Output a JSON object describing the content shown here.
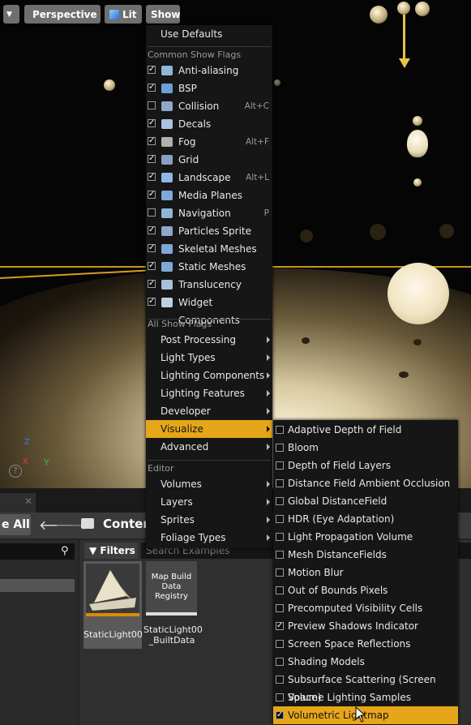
{
  "toolbar": {
    "perspective_label": "Perspective",
    "lit_label": "Lit",
    "show_label": "Show"
  },
  "show_menu": {
    "use_defaults": "Use Defaults",
    "common_header": "Common Show Flags",
    "common_flags": [
      {
        "label": "Anti-aliasing",
        "checked": true,
        "shortcut": "",
        "icon": "anti-aliasing-icon",
        "color": "#8fb7d8"
      },
      {
        "label": "BSP",
        "checked": true,
        "shortcut": "",
        "icon": "bsp-icon",
        "color": "#6f9fd8"
      },
      {
        "label": "Collision",
        "checked": false,
        "shortcut": "Alt+C",
        "icon": "collision-icon",
        "color": "#8fa8c8"
      },
      {
        "label": "Decals",
        "checked": true,
        "shortcut": "",
        "icon": "decals-icon",
        "color": "#aac4e0"
      },
      {
        "label": "Fog",
        "checked": true,
        "shortcut": "Alt+F",
        "icon": "fog-icon",
        "color": "#b0b0b0"
      },
      {
        "label": "Grid",
        "checked": true,
        "shortcut": "",
        "icon": "grid-icon",
        "color": "#8aa0c0"
      },
      {
        "label": "Landscape",
        "checked": true,
        "shortcut": "Alt+L",
        "icon": "landscape-icon",
        "color": "#8fb7e8"
      },
      {
        "label": "Media Planes",
        "checked": true,
        "shortcut": "",
        "icon": "media-planes-icon",
        "color": "#7fa8d8"
      },
      {
        "label": "Navigation",
        "checked": false,
        "shortcut": "P",
        "icon": "navigation-icon",
        "color": "#8fb7d8"
      },
      {
        "label": "Particles Sprite",
        "checked": true,
        "shortcut": "",
        "icon": "particles-icon",
        "color": "#8fa8c8"
      },
      {
        "label": "Skeletal Meshes",
        "checked": true,
        "shortcut": "",
        "icon": "skeletal-mesh-icon",
        "color": "#7fa8d8"
      },
      {
        "label": "Static Meshes",
        "checked": true,
        "shortcut": "",
        "icon": "static-mesh-icon",
        "color": "#7fa8d8"
      },
      {
        "label": "Translucency",
        "checked": true,
        "shortcut": "",
        "icon": "translucency-icon",
        "color": "#a8c0d8"
      },
      {
        "label": "Widget Components",
        "checked": true,
        "shortcut": "",
        "icon": "widget-components-icon",
        "color": "#c0d0e0"
      }
    ],
    "all_header": "All Show Flags",
    "all_items": [
      {
        "label": "Post Processing",
        "highlighted": false
      },
      {
        "label": "Light Types",
        "highlighted": false
      },
      {
        "label": "Lighting Components",
        "highlighted": false
      },
      {
        "label": "Lighting Features",
        "highlighted": false
      },
      {
        "label": "Developer",
        "highlighted": false
      },
      {
        "label": "Visualize",
        "highlighted": true
      },
      {
        "label": "Advanced",
        "highlighted": false
      }
    ],
    "editor_header": "Editor",
    "editor_items": [
      {
        "label": "Volumes"
      },
      {
        "label": "Layers"
      },
      {
        "label": "Sprites"
      },
      {
        "label": "Foliage Types"
      }
    ]
  },
  "visualize_menu": {
    "items": [
      {
        "label": "Adaptive Depth of Field",
        "checked": false,
        "highlighted": false
      },
      {
        "label": "Bloom",
        "checked": false,
        "highlighted": false
      },
      {
        "label": "Depth of Field Layers",
        "checked": false,
        "highlighted": false
      },
      {
        "label": "Distance Field Ambient Occlusion",
        "checked": false,
        "highlighted": false
      },
      {
        "label": "Global DistanceField",
        "checked": false,
        "highlighted": false
      },
      {
        "label": "HDR (Eye Adaptation)",
        "checked": false,
        "highlighted": false
      },
      {
        "label": "Light Propagation Volume",
        "checked": false,
        "highlighted": false
      },
      {
        "label": "Mesh DistanceFields",
        "checked": false,
        "highlighted": false
      },
      {
        "label": "Motion Blur",
        "checked": false,
        "highlighted": false
      },
      {
        "label": "Out of Bounds Pixels",
        "checked": false,
        "highlighted": false
      },
      {
        "label": "Precomputed Visibility Cells",
        "checked": false,
        "highlighted": false
      },
      {
        "label": "Preview Shadows Indicator",
        "checked": true,
        "highlighted": false
      },
      {
        "label": "Screen Space Reflections",
        "checked": false,
        "highlighted": false
      },
      {
        "label": "Shading Models",
        "checked": false,
        "highlighted": false
      },
      {
        "label": "Subsurface Scattering (Screen Space)",
        "checked": false,
        "highlighted": false
      },
      {
        "label": "Volume Lighting Samples",
        "checked": false,
        "highlighted": false
      },
      {
        "label": "Volumetric Lightmap",
        "checked": true,
        "highlighted": true
      }
    ]
  },
  "viewport": {
    "axis_z": "Z",
    "axis_x": "X",
    "axis_y": "Y"
  },
  "content_browser": {
    "save_all": "e All",
    "content_label": "Content",
    "filters_label": "Filters",
    "search_placeholder": "Search Examples",
    "assets": [
      {
        "name": "StaticLight00"
      },
      {
        "name": "StaticLight00\n_BuiltData",
        "thumb_text": "Map Build Data Registry"
      }
    ]
  },
  "colors": {
    "highlight": "#e6a619",
    "menu_bg": "#161616"
  }
}
